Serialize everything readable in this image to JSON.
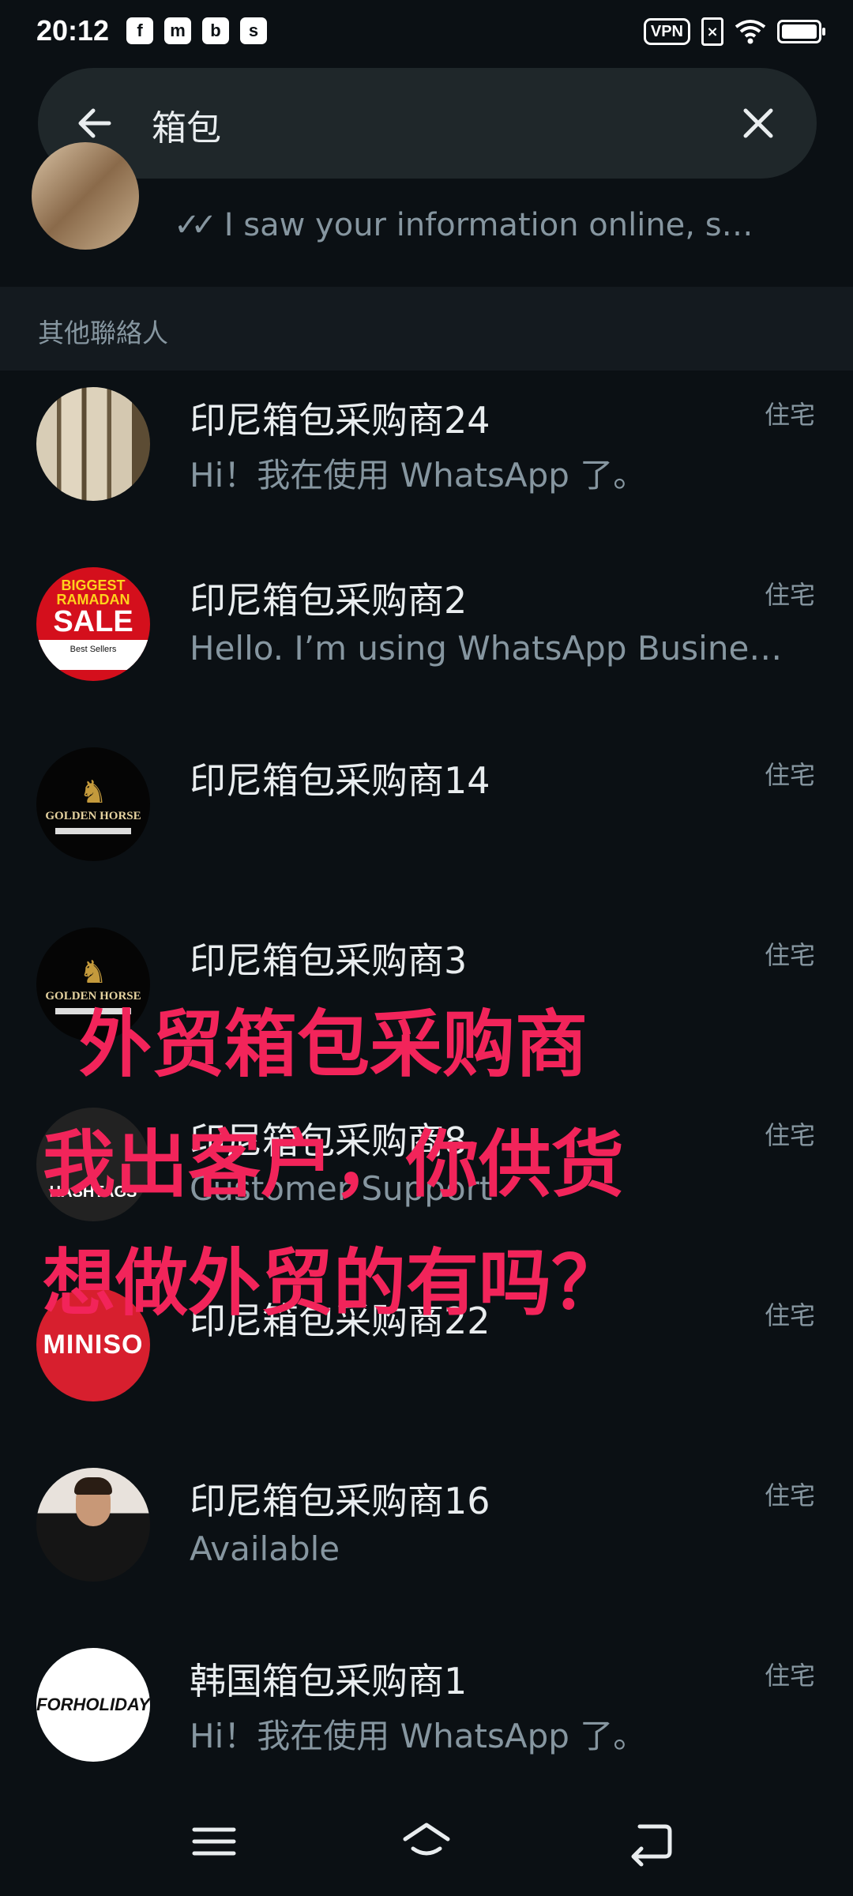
{
  "status_bar": {
    "time": "20:12",
    "app_icons": [
      "f",
      "m",
      "b",
      "s"
    ],
    "vpn_label": "VPN",
    "sim_label": "×"
  },
  "search": {
    "query": "箱包"
  },
  "partial_result": {
    "message": "I saw your information online, s…"
  },
  "section": {
    "title": "其他聯絡人"
  },
  "contacts": [
    {
      "name": "印尼箱包采购商24",
      "status": "Hi！我在使用 WhatsApp 了。",
      "tag": "住宅"
    },
    {
      "name": "印尼箱包采购商2",
      "status": "Hello. I’m using WhatsApp Busine…",
      "tag": "住宅",
      "avatar_text": {
        "big": "BIGGEST RAMADAN",
        "sale": "SALE",
        "sub": "Best Sellers"
      }
    },
    {
      "name": "印尼箱包采购商14",
      "status": "",
      "tag": "住宅",
      "avatar_text": "GOLDEN HORSE"
    },
    {
      "name": "印尼箱包采购商3",
      "status": "",
      "tag": "住宅",
      "avatar_text": "GOLDEN HORSE"
    },
    {
      "name": "印尼箱包采购商8",
      "status": "Customer Support",
      "tag": "住宅",
      "avatar_text": "HASHTAGS"
    },
    {
      "name": "印尼箱包采购商22",
      "status": "",
      "tag": "住宅",
      "avatar_text": "MINISO"
    },
    {
      "name": "印尼箱包采购商16",
      "status": "Available",
      "tag": "住宅"
    },
    {
      "name": "韩国箱包采购商1",
      "status": "Hi！我在使用 WhatsApp 了。",
      "tag": "住宅",
      "avatar_text": "FORHOLIDAY"
    }
  ],
  "overlay_text": [
    "外贸箱包采购商",
    "我出客户，你供货",
    "想做外贸的有吗？"
  ],
  "colors": {
    "background": "#0b1014",
    "search_bar": "#1f272a",
    "section_header": "#141a1f",
    "overlay_text": "#f2245a",
    "secondary_text": "#8696a0"
  }
}
